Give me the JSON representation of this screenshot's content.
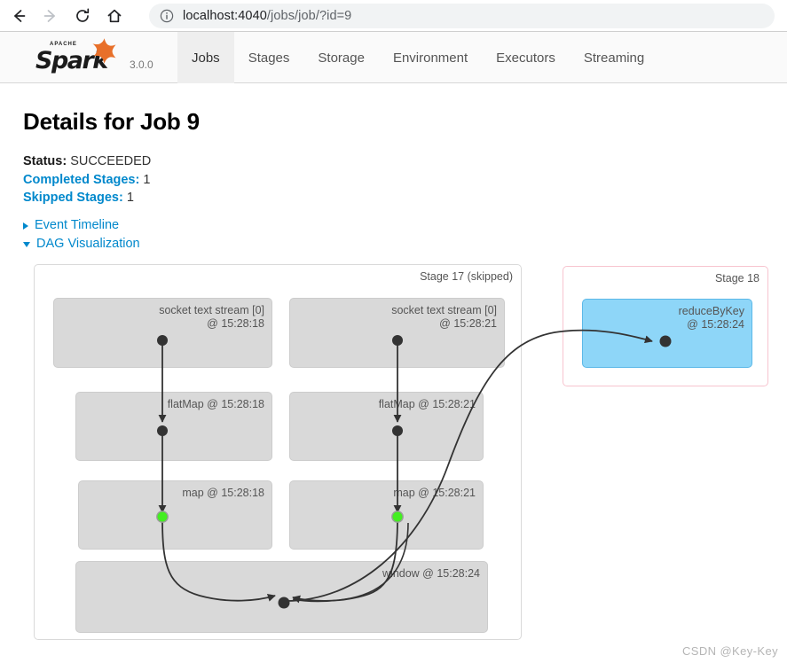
{
  "browser": {
    "back_icon": "back-arrow-icon",
    "forward_icon": "forward-arrow-icon",
    "reload_icon": "reload-icon",
    "home_icon": "home-icon",
    "info_icon": "info-circle-icon",
    "url_host": "localhost:4040",
    "url_path": "/jobs/job/?id=9",
    "url_full": "localhost:4040/jobs/job/?id=9"
  },
  "navbar": {
    "brand_apache": "APACHE",
    "brand_name": "Spark",
    "version": "3.0.0",
    "tabs": [
      {
        "label": "Jobs",
        "active": true
      },
      {
        "label": "Stages",
        "active": false
      },
      {
        "label": "Storage",
        "active": false
      },
      {
        "label": "Environment",
        "active": false
      },
      {
        "label": "Executors",
        "active": false
      },
      {
        "label": "Streaming",
        "active": false
      }
    ]
  },
  "page": {
    "title": "Details for Job 9",
    "meta": [
      {
        "label": "Status:",
        "value": "SUCCEEDED",
        "label_style": "dark"
      },
      {
        "label": "Completed Stages:",
        "value": "1",
        "label_style": "link"
      },
      {
        "label": "Skipped Stages:",
        "value": "1",
        "label_style": "link"
      }
    ],
    "toggles": [
      {
        "label": "Event Timeline",
        "expanded": false
      },
      {
        "label": "DAG Visualization",
        "expanded": true
      }
    ]
  },
  "dag": {
    "stages": [
      {
        "id": "stage-17",
        "label": "Stage 17 (skipped)",
        "border_color": "#d9d9d9"
      },
      {
        "id": "stage-18",
        "label": "Stage 18",
        "border_color": "#f7c4cf"
      }
    ],
    "rdds": [
      {
        "id": "socket-left",
        "label": "socket text stream [0]\n@ 15:28:18",
        "stage": "Stage 17 (skipped)",
        "cached": false
      },
      {
        "id": "socket-right",
        "label": "socket text stream [0]\n@ 15:28:21",
        "stage": "Stage 17 (skipped)",
        "cached": false
      },
      {
        "id": "flatmap-left",
        "label": "flatMap @ 15:28:18",
        "stage": "Stage 17 (skipped)",
        "cached": false
      },
      {
        "id": "flatmap-right",
        "label": "flatMap @ 15:28:21",
        "stage": "Stage 17 (skipped)",
        "cached": false
      },
      {
        "id": "map-left",
        "label": "map @ 15:28:18",
        "stage": "Stage 17 (skipped)",
        "cached": true
      },
      {
        "id": "map-right",
        "label": "map @ 15:28:21",
        "stage": "Stage 17 (skipped)",
        "cached": true
      },
      {
        "id": "window",
        "label": "window @ 15:28:24",
        "stage": "Stage 17 (skipped)",
        "cached": false
      },
      {
        "id": "reducebykey",
        "label": "reduceByKey\n@ 15:28:24",
        "stage": "Stage 18",
        "cached": false
      }
    ],
    "colors": {
      "rdd_fill": "#d9d9d9",
      "rdd_stroke": "#cccccc",
      "stage18_fill": "#8ed6f8",
      "stage18_stroke": "#5bb8e8",
      "stage18_border": "#f7c4cf",
      "edge": "#333333",
      "cached_node": "#44ee22",
      "node": "#333333"
    }
  },
  "watermark": "CSDN @Key-Key"
}
